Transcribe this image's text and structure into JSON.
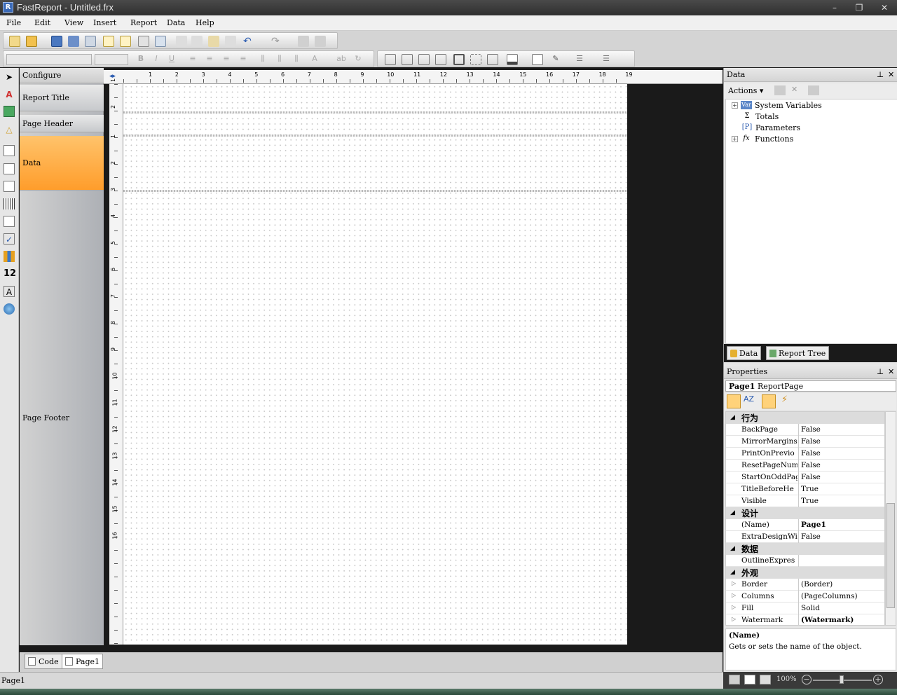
{
  "window": {
    "title": "FastReport - Untitled.frx",
    "minimize": "–",
    "maximize": "❐",
    "close": "✕"
  },
  "menu": [
    "File",
    "Edit",
    "View",
    "Insert",
    "Report",
    "Data",
    "Help"
  ],
  "bands": {
    "configure": "Configure",
    "report_title": "Report Title",
    "page_header": "Page Header",
    "data": "Data",
    "page_footer": "Page Footer"
  },
  "ruler_h": [
    "1",
    "2",
    "3",
    "4",
    "5",
    "6",
    "7",
    "8",
    "9",
    "10",
    "11",
    "12",
    "13",
    "14",
    "15",
    "16",
    "17",
    "18",
    "19"
  ],
  "ruler_v": [
    "1",
    "2",
    "1",
    "2",
    "3",
    "4",
    "5",
    "6",
    "7",
    "8",
    "9",
    "10",
    "11",
    "12",
    "13",
    "14",
    "15",
    "16"
  ],
  "tabs": {
    "code": "Code",
    "page1": "Page1"
  },
  "status": {
    "text": "Page1",
    "zoom": "100%"
  },
  "data_panel": {
    "title": "Data",
    "actions": "Actions",
    "tree": [
      {
        "label": "System Variables",
        "icon": "var-icon",
        "expandable": true
      },
      {
        "label": "Totals",
        "icon": "sigma-icon",
        "expandable": false
      },
      {
        "label": "Parameters",
        "icon": "parameters-icon",
        "expandable": false
      },
      {
        "label": "Functions",
        "icon": "fx-icon",
        "expandable": true
      }
    ]
  },
  "right_tabs": {
    "data": "Data",
    "report_tree": "Report Tree"
  },
  "properties": {
    "title": "Properties",
    "object": "Page1",
    "object_type": "ReportPage",
    "categories": [
      {
        "name": "行为",
        "rows": [
          {
            "name": "BackPage",
            "value": "False"
          },
          {
            "name": "MirrorMargins",
            "value": "False"
          },
          {
            "name": "PrintOnPrevio",
            "value": "False"
          },
          {
            "name": "ResetPageNumb",
            "value": "False"
          },
          {
            "name": "StartOnOddPag",
            "value": "False"
          },
          {
            "name": "TitleBeforeHe",
            "value": "True"
          },
          {
            "name": "Visible",
            "value": "True"
          }
        ]
      },
      {
        "name": "设计",
        "rows": [
          {
            "name": "(Name)",
            "value": "Page1"
          },
          {
            "name": "ExtraDesignWi",
            "value": "False"
          }
        ]
      },
      {
        "name": "数据",
        "rows": [
          {
            "name": "OutlineExpres",
            "value": ""
          }
        ]
      },
      {
        "name": "外观",
        "rows": [
          {
            "name": "Border",
            "value": "(Border)"
          },
          {
            "name": "Columns",
            "value": "(PageColumns)"
          },
          {
            "name": "Fill",
            "value": "Solid"
          },
          {
            "name": "Watermark",
            "value": "(Watermark)"
          }
        ]
      }
    ],
    "desc_title": "(Name)",
    "desc_text": "Gets or sets the name of the object."
  }
}
